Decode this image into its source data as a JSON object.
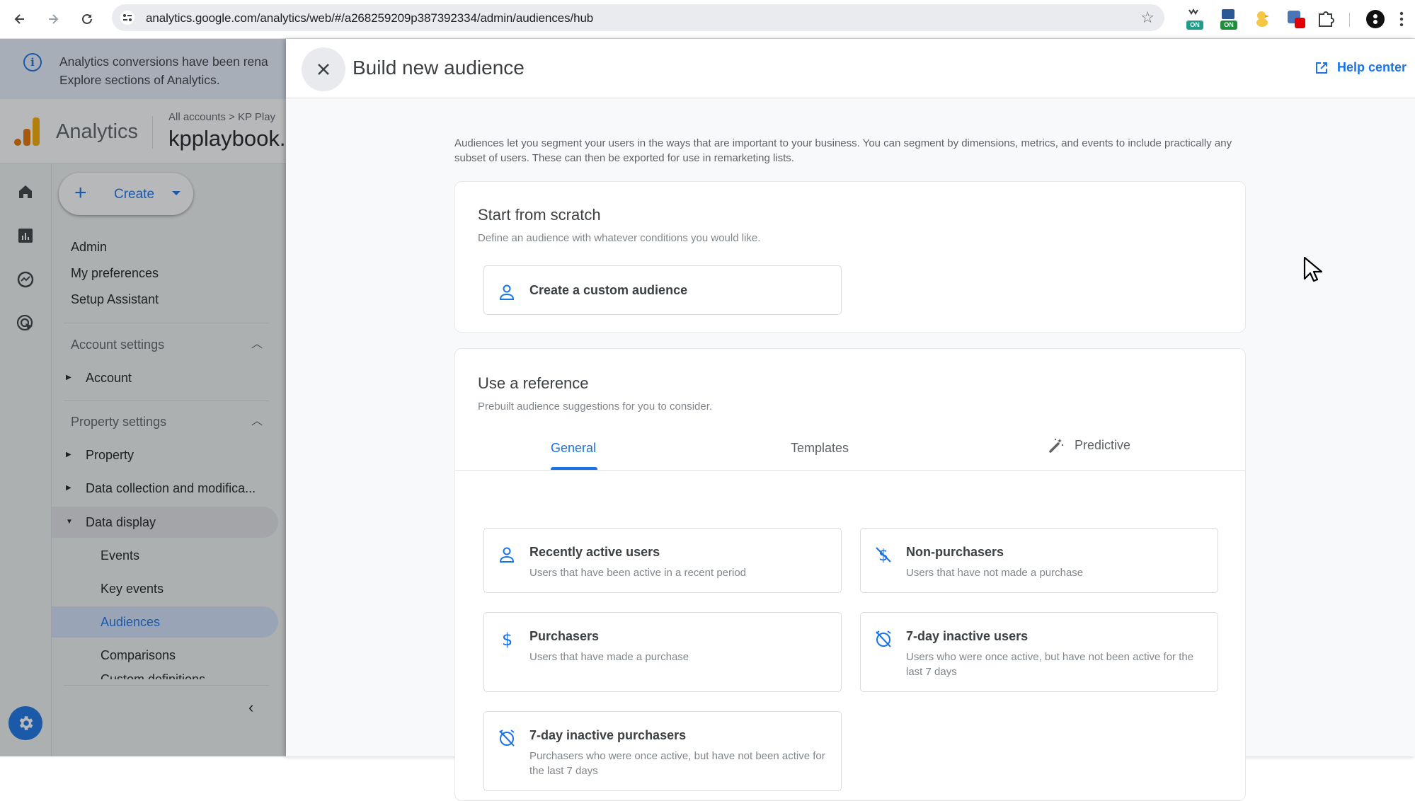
{
  "browser": {
    "url": "analytics.google.com/analytics/web/#/a268259209p387392334/admin/audiences/hub",
    "nav": {
      "back_icon": "arrow-left",
      "forward_icon": "arrow-right",
      "reload_icon": "reload"
    },
    "bookmark_icon": "star-outline",
    "extensions": [
      {
        "name": "extension-1",
        "badge": "ON",
        "badge_color": "#1e9e8a"
      },
      {
        "name": "extension-2",
        "badge": "ON",
        "badge_color": "#1e8e3e"
      },
      {
        "name": "extension-3",
        "badge": "",
        "badge_color": ""
      },
      {
        "name": "extension-4",
        "badge": "",
        "badge_color": "#e00000"
      },
      {
        "name": "extensions-puzzle",
        "badge": "",
        "badge_color": ""
      }
    ]
  },
  "background_app": {
    "banner": {
      "line1": "Analytics conversions have been rena",
      "line2": "Explore sections of Analytics."
    },
    "app_name": "Analytics",
    "breadcrumb": "All accounts > KP Play",
    "property_name": "kpplaybook.c",
    "create_label": "Create",
    "nav": {
      "admin": "Admin",
      "my_preferences": "My preferences",
      "setup_assistant": "Setup Assistant",
      "account_settings": "Account settings",
      "account": "Account",
      "property_settings": "Property settings",
      "property": "Property",
      "data_collection": "Data collection and modifica...",
      "data_display": "Data display",
      "events": "Events",
      "key_events": "Key events",
      "audiences": "Audiences",
      "comparisons": "Comparisons",
      "custom_definitions": "Custom definitions"
    }
  },
  "panel": {
    "title": "Build new audience",
    "help_label": "Help center",
    "intro": "Audiences let you segment your users in the ways that are important to your business. You can segment by dimensions, metrics, and events to include practically any subset of users. These can then be exported for use in remarketing lists.",
    "scratch": {
      "title": "Start from scratch",
      "subtitle": "Define an audience with whatever conditions you would like.",
      "custom_label": "Create a custom audience"
    },
    "reference": {
      "title": "Use a reference",
      "subtitle": "Prebuilt audience suggestions for you to consider.",
      "tabs": [
        {
          "label": "General",
          "active": true
        },
        {
          "label": "Templates",
          "active": false
        },
        {
          "label": "Predictive",
          "active": false
        }
      ],
      "items": [
        {
          "title": "Recently active users",
          "desc": "Users that have been active in a recent period",
          "icon": "person"
        },
        {
          "title": "Non-purchasers",
          "desc": "Users that have not made a purchase",
          "icon": "money-off"
        },
        {
          "title": "Purchasers",
          "desc": "Users that have made a purchase",
          "icon": "dollar"
        },
        {
          "title": "7-day inactive users",
          "desc": "Users who were once active, but have not been active for the last 7 days",
          "icon": "alarm-off"
        },
        {
          "title": "7-day inactive purchasers",
          "desc": "Purchasers who were once active, but have not been active for the last 7 days",
          "icon": "alarm-off"
        }
      ]
    }
  },
  "colors": {
    "accent": "#1a73e8",
    "selected_bg": "#d3e3fd",
    "ga_orange": "#e37400",
    "ga_yellow": "#f9ab00"
  }
}
